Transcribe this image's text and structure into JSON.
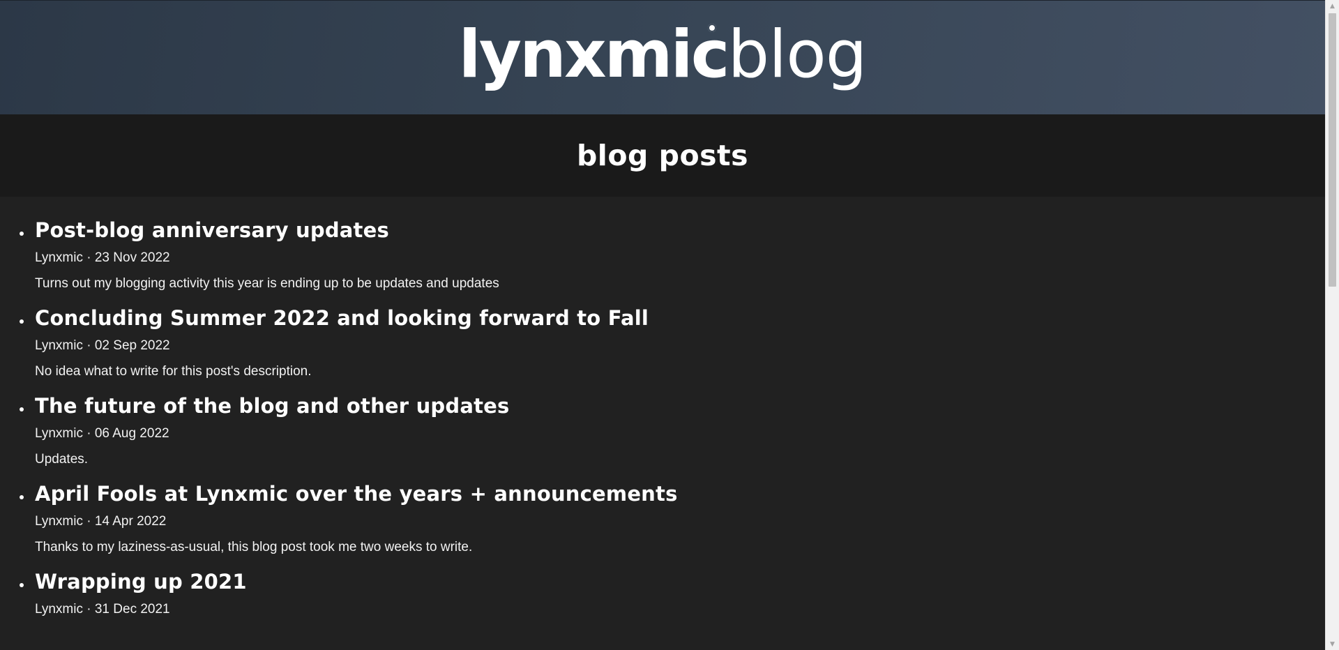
{
  "header": {
    "logo_bold": "lynxmic",
    "logo_light": "blog"
  },
  "page": {
    "title": "blog posts"
  },
  "posts": [
    {
      "title": "Post-blog anniversary updates",
      "meta": "Lynxmic · 23 Nov 2022",
      "description": "Turns out my blogging activity this year is ending up to be updates and updates"
    },
    {
      "title": "Concluding Summer 2022 and looking forward to Fall",
      "meta": "Lynxmic · 02 Sep 2022",
      "description": "No idea what to write for this post's description."
    },
    {
      "title": "The future of the blog and other updates",
      "meta": "Lynxmic · 06 Aug 2022",
      "description": "Updates."
    },
    {
      "title": "April Fools at Lynxmic over the years + announcements",
      "meta": "Lynxmic · 14 Apr 2022",
      "description": "Thanks to my laziness-as-usual, this blog post took me two weeks to write."
    },
    {
      "title": "Wrapping up 2021",
      "meta": "Lynxmic · 31 Dec 2021",
      "description": ""
    }
  ],
  "scrollbar": {
    "position": 0.0
  }
}
